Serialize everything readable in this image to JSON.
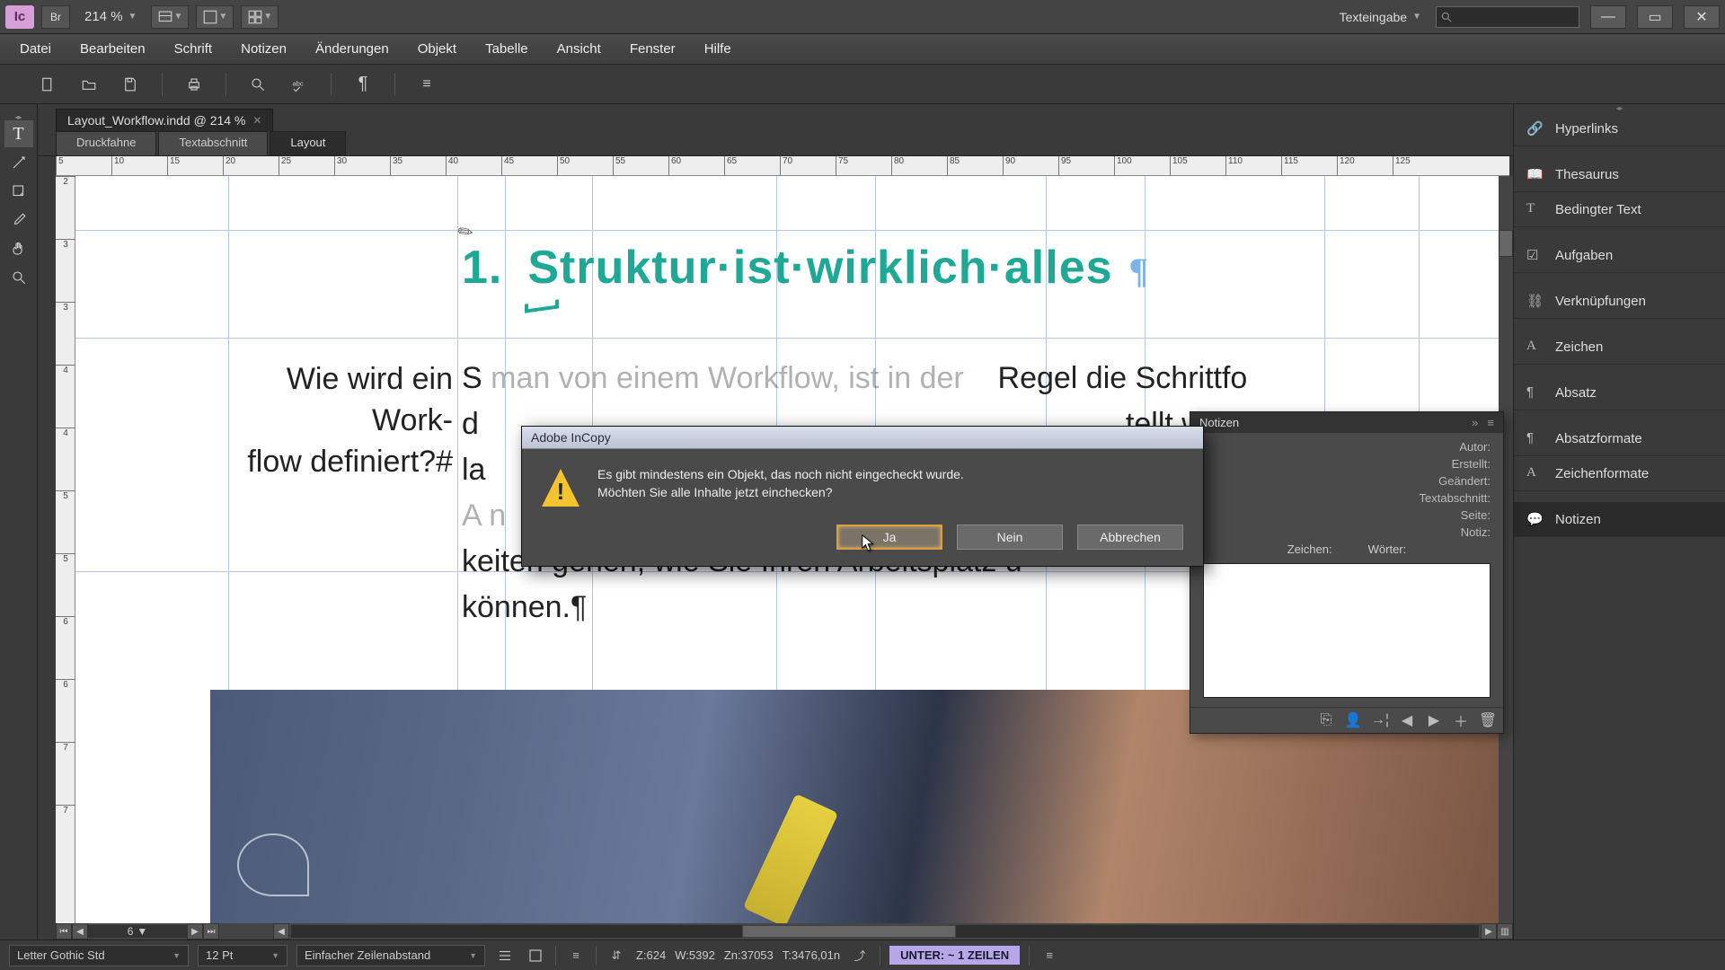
{
  "app": {
    "code": "Ic",
    "bridge": "Br"
  },
  "titlebar": {
    "zoom": "214 %",
    "workspace": "Texteingabe"
  },
  "menu": [
    "Datei",
    "Bearbeiten",
    "Schrift",
    "Notizen",
    "Änderungen",
    "Objekt",
    "Tabelle",
    "Ansicht",
    "Fenster",
    "Hilfe"
  ],
  "doc": {
    "tab": "Layout_Workflow.indd @ 214 %"
  },
  "view_tabs": [
    "Druckfahne",
    "Textabschnitt",
    "Layout"
  ],
  "ruler_h": [
    "5",
    "10",
    "15",
    "20",
    "25",
    "30",
    "35",
    "40",
    "45",
    "50",
    "55",
    "60",
    "65",
    "70",
    "75",
    "80",
    "85",
    "90",
    "95",
    "100",
    "105",
    "110",
    "115",
    "120",
    "125"
  ],
  "ruler_v": [
    "2",
    "3",
    "3",
    "4",
    "4",
    "5",
    "5",
    "6",
    "6",
    "7",
    "7"
  ],
  "page": {
    "heading_num": "1.",
    "heading": "Struktur·ist·wirklich·alles",
    "side_line1": "Wie wird ein Work‑",
    "side_line2": "flow definiert?#",
    "body_l1_a": "S",
    "body_l1_b": " man von einem Workflow, ist in der",
    "body_l1_c": "Regel die Schrittfo",
    "body_l2_a": "d",
    "body_l2_c": "tellt wird. Je klare",
    "body_l3": "la",
    "body_l4": "A                                                                            n",
    "body_l5": "keiten gehen, wie Sie Ihren Arbeitsplatz u",
    "body_l6": "können.¶"
  },
  "dialog": {
    "title": "Adobe InCopy",
    "line1": "Es gibt mindestens ein Objekt, das noch nicht eingecheckt wurde.",
    "line2": "Möchten Sie alle Inhalte jetzt einchecken?",
    "yes": "Ja",
    "no": "Nein",
    "cancel": "Abbrechen"
  },
  "notes": {
    "tab": "Notizen",
    "author": "Autor:",
    "created": "Erstellt:",
    "modified": "Geändert:",
    "story": "Textabschnitt:",
    "page": "Seite:",
    "note": "Notiz:",
    "chars": "Zeichen:",
    "words": "Wörter:"
  },
  "right_panels": [
    "Hyperlinks",
    "Thesaurus",
    "Bedingter Text",
    "Aufgaben",
    "Verknüpfungen",
    "Zeichen",
    "Absatz",
    "Absatzformate",
    "Zeichenformate",
    "Notizen"
  ],
  "hscroll": {
    "page": "6"
  },
  "status": {
    "font": "Letter Gothic Std",
    "size": "12 Pt",
    "leading": "Einfacher Zeilenabstand",
    "z": "Z:624",
    "w": "W:5392",
    "zn": "Zn:37053",
    "t": "T:3476,01n",
    "fit": "UNTER:  ~ 1 ZEILEN"
  }
}
